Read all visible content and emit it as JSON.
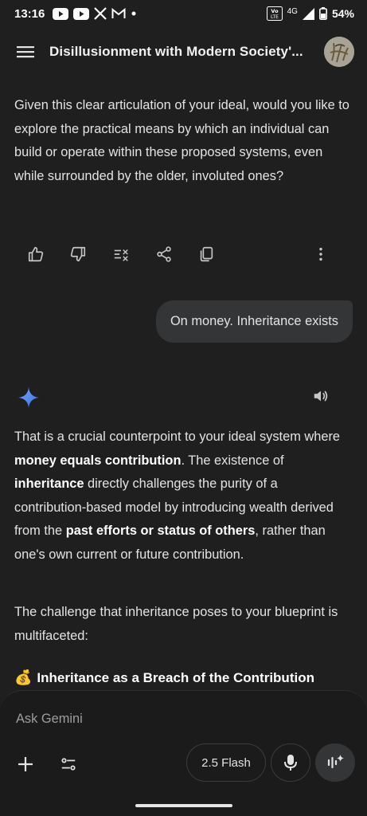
{
  "status_bar": {
    "time": "13:16",
    "notification_icons": [
      "youtube-icon",
      "youtube-icon",
      "x-icon",
      "gmail-icon",
      "dot-icon"
    ],
    "volte": "VoLTE",
    "network": "4G",
    "battery": "54%"
  },
  "app_bar": {
    "title": "Disillusionment with Modern Society'..."
  },
  "messages": {
    "model_prev": {
      "text": "Given this clear articulation of your ideal, would you like to explore the practical means by which an individual can build or operate within these proposed systems, even while surrounded by the older, involuted ones?"
    },
    "user": {
      "text": "On money. Inheritance exists"
    },
    "model_current": {
      "p1": {
        "a": "That is a crucial counterpoint to your ideal system where ",
        "b1": "money equals contribution",
        "c": ". The existence of ",
        "b2": "inheritance",
        "d": " directly challenges the purity of a contribution-based model by introducing wealth derived from the ",
        "b3": "past efforts or status of others",
        "e": ", rather than one's own current or future contribution."
      },
      "p2": "The challenge that inheritance poses to your blueprint is multifaceted:",
      "heading_emoji": "💰",
      "heading": "Inheritance as a Breach of the Contribution"
    }
  },
  "action_icons": [
    "thumb-up-icon",
    "thumb-down-icon",
    "modify-response-icon",
    "share-icon",
    "copy-icon",
    "more-vert-icon"
  ],
  "input": {
    "placeholder": "Ask Gemini",
    "model_label": "2.5 Flash"
  },
  "colors": {
    "background": "#1f1f1f",
    "bubble": "#333537",
    "gemini_blue": "#4a8bf5",
    "text": "#e3e3e3"
  }
}
